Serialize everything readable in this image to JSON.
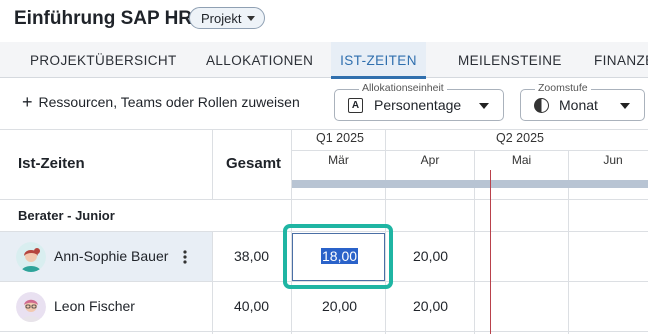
{
  "app": {
    "title": "Einführung SAP HR",
    "project_badge": "Projekt"
  },
  "tabs": [
    {
      "label": "PROJEKTÜBERSICHT",
      "active": false
    },
    {
      "label": "ALLOKATIONEN",
      "active": false
    },
    {
      "label": "IST-ZEITEN",
      "active": true
    },
    {
      "label": "MEILENSTEINE",
      "active": false
    },
    {
      "label": "FINANZE",
      "active": false
    }
  ],
  "toolbar": {
    "assign_label": "Ressourcen, Teams oder Rollen zuweisen",
    "allocation_unit": {
      "label": "Allokationseinheit",
      "value": "Personentage",
      "icon": "A"
    },
    "zoom": {
      "label": "Zoomstufe",
      "value": "Monat"
    }
  },
  "grid": {
    "title": "Ist-Zeiten",
    "total_header": "Gesamt",
    "quarters": [
      "Q1 2025",
      "Q2 2025"
    ],
    "months": [
      "Mär",
      "Apr",
      "Mai",
      "Jun"
    ],
    "group": "Berater - Junior",
    "rows": [
      {
        "name": "Ann-Sophie Bauer",
        "total": "38,00",
        "values": [
          "18,00",
          "20,00",
          "",
          ""
        ]
      },
      {
        "name": "Leon Fischer",
        "total": "40,00",
        "values": [
          "20,00",
          "20,00",
          "",
          ""
        ]
      }
    ]
  },
  "colors": {
    "accent": "#2f6fae",
    "focus_ring": "#1fb5a3",
    "today_line": "#b9414b",
    "timeline_bar": "#b8c4d3"
  }
}
